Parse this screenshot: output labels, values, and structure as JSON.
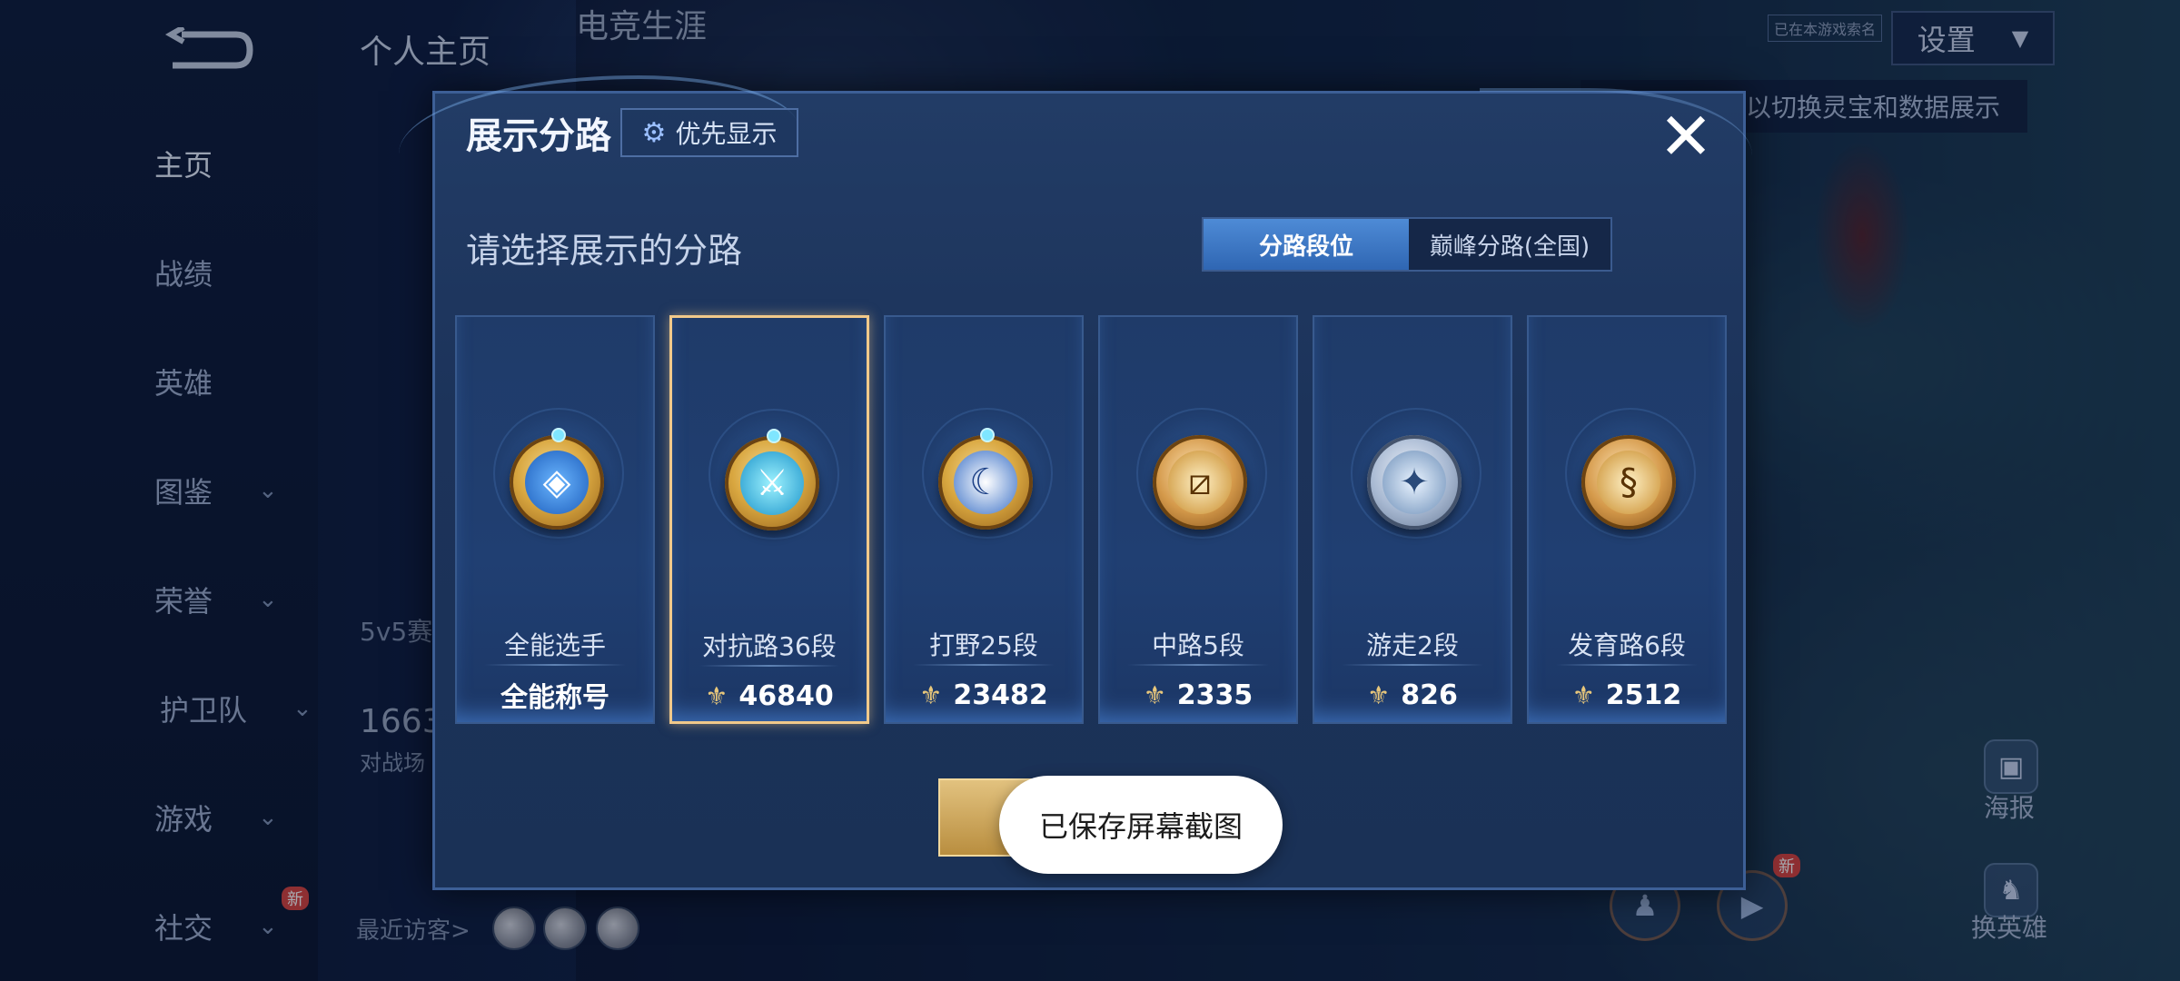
{
  "nav": {
    "items": [
      {
        "label": "主页",
        "chevron": false,
        "active": true
      },
      {
        "label": "战绩",
        "chevron": false
      },
      {
        "label": "英雄",
        "chevron": false
      },
      {
        "label": "图鉴",
        "chevron": true
      },
      {
        "label": "荣誉",
        "chevron": true
      },
      {
        "label": "护卫队",
        "chevron": true
      },
      {
        "label": "游戏",
        "chevron": true
      },
      {
        "label": "社交",
        "chevron": true,
        "badge": "新"
      }
    ]
  },
  "top_tabs": [
    "个人主页",
    "电竞生涯"
  ],
  "settings": {
    "label": "设置",
    "hint": "已在本游戏索名"
  },
  "hint_strip": "以切换灵宝和数据展示",
  "profile": {
    "mode": "5v5赛",
    "count": "1663",
    "count_label": "对战场",
    "visitors_label": "最近访客>"
  },
  "right_buttons": {
    "poster": "海报",
    "change_hero": "换英雄",
    "new_tag": "新"
  },
  "modal": {
    "title": "展示分路",
    "priority_label": "优先显示",
    "subtitle": "请选择展示的分路",
    "segments": [
      "分路段位",
      "巅峰分路(全国)"
    ],
    "close_symbol": "✕",
    "cards": [
      {
        "lane": "全能选手",
        "value": "全能称号",
        "has_icon": false,
        "selected": false
      },
      {
        "lane": "对抗路36段",
        "value": "46840",
        "has_icon": true,
        "selected": true
      },
      {
        "lane": "打野25段",
        "value": "23482",
        "has_icon": true,
        "selected": false
      },
      {
        "lane": "中路5段",
        "value": "2335",
        "has_icon": true,
        "selected": false
      },
      {
        "lane": "游走2段",
        "value": "826",
        "has_icon": true,
        "selected": false
      },
      {
        "lane": "发育路6段",
        "value": "2512",
        "has_icon": true,
        "selected": false
      }
    ]
  },
  "toast": "已保存屏幕截图"
}
